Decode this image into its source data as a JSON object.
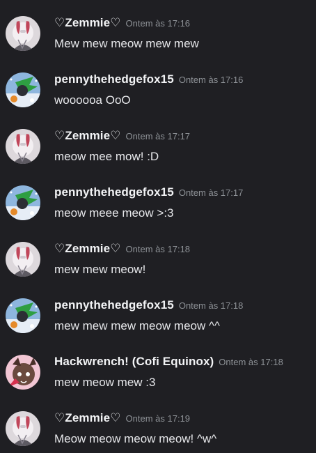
{
  "messages": [
    {
      "author": "♡Zemmie♡",
      "avatar": "zemmie-avatar-icon",
      "timestamp": "Ontem às 17:16",
      "text": "Mew mew meow mew mew"
    },
    {
      "author": "pennythehedgefox15",
      "avatar": "penny-avatar-icon",
      "timestamp": "Ontem às 17:16",
      "text": "woooooa OoO"
    },
    {
      "author": "♡Zemmie♡",
      "avatar": "zemmie-avatar-icon",
      "timestamp": "Ontem às 17:17",
      "text": "meow mee mow! :D"
    },
    {
      "author": "pennythehedgefox15",
      "avatar": "penny-avatar-icon",
      "timestamp": "Ontem às 17:17",
      "text": "meow meee meow >:3"
    },
    {
      "author": "♡Zemmie♡",
      "avatar": "zemmie-avatar-icon",
      "timestamp": "Ontem às 17:18",
      "text": "mew mew meow!"
    },
    {
      "author": "pennythehedgefox15",
      "avatar": "penny-avatar-icon",
      "timestamp": "Ontem às 17:18",
      "text": "mew mew mew meow meow ^^"
    },
    {
      "author": "Hackwrench! (Cofi Equinox)",
      "avatar": "hackwrench-avatar-icon",
      "timestamp": "Ontem às 17:18",
      "text": "mew meow mew :3"
    },
    {
      "author": "♡Zemmie♡",
      "avatar": "zemmie-avatar-icon",
      "timestamp": "Ontem às 17:19",
      "text": "Meow meow meow meow! ^w^"
    }
  ],
  "colors": {
    "background": "#1f1f23",
    "username": "#f2f3f5",
    "timestamp": "#8e9297",
    "text": "#e6e7ea"
  }
}
